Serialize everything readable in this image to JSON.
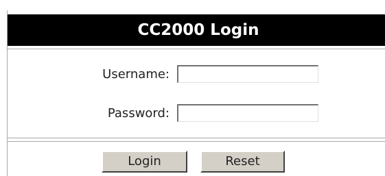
{
  "header": {
    "title": "CC2000 Login"
  },
  "form": {
    "username_label": "Username:",
    "username_value": "",
    "password_label": "Password:",
    "password_value": ""
  },
  "buttons": {
    "login_label": "Login",
    "reset_label": "Reset"
  },
  "colors": {
    "title_bar_background": "#000000",
    "title_text": "#ffffff",
    "button_face": "#d4d0c8"
  }
}
